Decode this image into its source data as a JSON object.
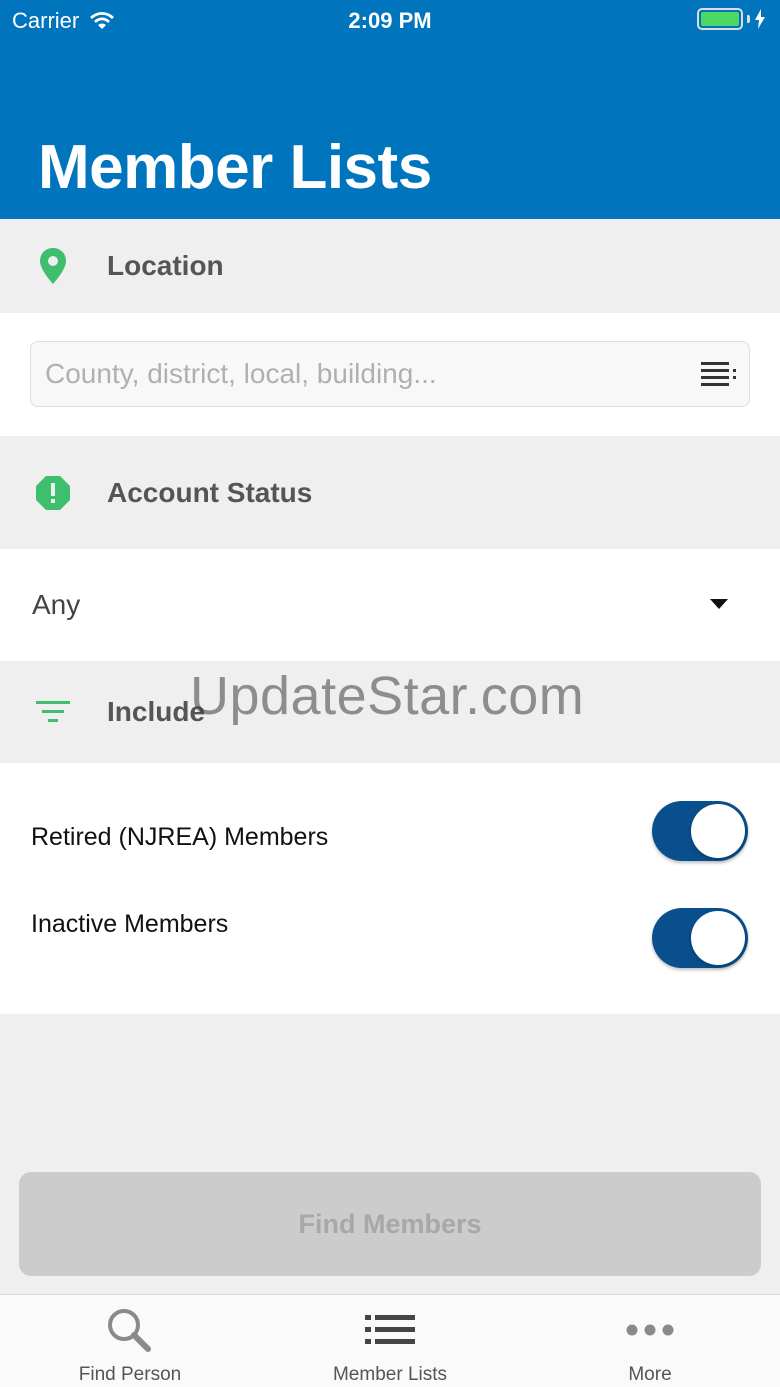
{
  "status_bar": {
    "carrier": "Carrier",
    "time": "2:09 PM"
  },
  "header": {
    "title": "Member Lists"
  },
  "location": {
    "heading": "Location",
    "search_placeholder": "County, district, local, building..."
  },
  "account_status": {
    "heading": "Account Status",
    "selected": "Any"
  },
  "include": {
    "heading": "Include",
    "options": [
      {
        "label": "Retired (NJREA) Members",
        "on": true
      },
      {
        "label": "Inactive Members",
        "on": true
      }
    ]
  },
  "watermark": "UpdateStar.com",
  "actions": {
    "find_members": "Find Members"
  },
  "tabbar": {
    "items": [
      {
        "label": "Find Person",
        "icon": "search-icon"
      },
      {
        "label": "Member Lists",
        "icon": "list-icon"
      },
      {
        "label": "More",
        "icon": "more-icon"
      }
    ]
  },
  "colors": {
    "header": "#0075be",
    "accent_green": "#3dbf6e",
    "toggle_on": "#0a4f8d"
  }
}
